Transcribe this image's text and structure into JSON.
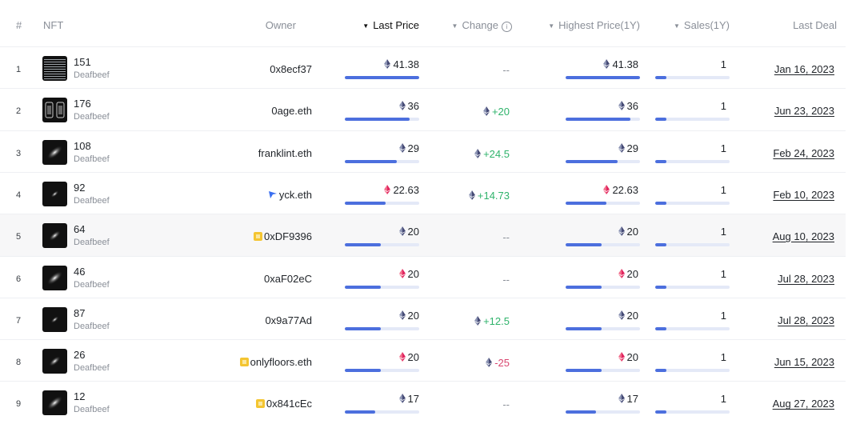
{
  "columns": {
    "index": "#",
    "nft": "NFT",
    "owner": "Owner",
    "last_price": "Last Price",
    "change": "Change",
    "highest_price": "Highest Price(1Y)",
    "sales": "Sales(1Y)",
    "last_deal": "Last Deal"
  },
  "sort": {
    "active_column": "last_price",
    "direction_icon": "caret-down-icon"
  },
  "colors": {
    "accent": "#4c6fde",
    "positive": "#2fb36b",
    "negative": "#d9466f",
    "muted": "#8a8f98"
  },
  "rows": [
    {
      "index": "1",
      "nft_id": "151",
      "collection": "Deafbeef",
      "owner": "0x8ecf37",
      "owner_icon": "",
      "last_price": "41.38",
      "last_price_icon": "eth-icon",
      "last_price_fraction": 1.0,
      "change": "--",
      "change_type": "none",
      "highest_price": "41.38",
      "highest_price_icon": "eth-icon",
      "highest_price_fraction": 1.0,
      "sales": "1",
      "sales_fraction": 0.15,
      "last_deal": "Jan 16, 2023",
      "highlight": false
    },
    {
      "index": "2",
      "nft_id": "176",
      "collection": "Deafbeef",
      "owner": "0age.eth",
      "owner_icon": "",
      "last_price": "36",
      "last_price_icon": "eth-icon",
      "last_price_fraction": 0.87,
      "change": "+20",
      "change_type": "pos",
      "highest_price": "36",
      "highest_price_icon": "eth-icon",
      "highest_price_fraction": 0.87,
      "sales": "1",
      "sales_fraction": 0.15,
      "last_deal": "Jun 23, 2023",
      "highlight": false
    },
    {
      "index": "3",
      "nft_id": "108",
      "collection": "Deafbeef",
      "owner": "franklint.eth",
      "owner_icon": "",
      "last_price": "29",
      "last_price_icon": "eth-icon",
      "last_price_fraction": 0.7,
      "change": "+24.5",
      "change_type": "pos",
      "highest_price": "29",
      "highest_price_icon": "eth-icon",
      "highest_price_fraction": 0.7,
      "sales": "1",
      "sales_fraction": 0.15,
      "last_deal": "Feb 24, 2023",
      "highlight": false
    },
    {
      "index": "4",
      "nft_id": "92",
      "collection": "Deafbeef",
      "owner": "yck.eth",
      "owner_icon": "blur-icon",
      "last_price": "22.63",
      "last_price_icon": "weth-icon",
      "last_price_fraction": 0.55,
      "change": "+14.73",
      "change_type": "pos",
      "highest_price": "22.63",
      "highest_price_icon": "weth-icon",
      "highest_price_fraction": 0.55,
      "sales": "1",
      "sales_fraction": 0.15,
      "last_deal": "Feb 10, 2023",
      "highlight": false
    },
    {
      "index": "5",
      "nft_id": "64",
      "collection": "Deafbeef",
      "owner": "0xDF9396",
      "owner_icon": "contract-icon",
      "last_price": "20",
      "last_price_icon": "eth-icon",
      "last_price_fraction": 0.48,
      "change": "--",
      "change_type": "none",
      "highest_price": "20",
      "highest_price_icon": "eth-icon",
      "highest_price_fraction": 0.48,
      "sales": "1",
      "sales_fraction": 0.15,
      "last_deal": "Aug 10, 2023",
      "highlight": true
    },
    {
      "index": "6",
      "nft_id": "46",
      "collection": "Deafbeef",
      "owner": "0xaF02eC",
      "owner_icon": "",
      "last_price": "20",
      "last_price_icon": "weth-icon",
      "last_price_fraction": 0.48,
      "change": "--",
      "change_type": "none",
      "highest_price": "20",
      "highest_price_icon": "weth-icon",
      "highest_price_fraction": 0.48,
      "sales": "1",
      "sales_fraction": 0.15,
      "last_deal": "Jul 28, 2023",
      "highlight": false
    },
    {
      "index": "7",
      "nft_id": "87",
      "collection": "Deafbeef",
      "owner": "0x9a77Ad",
      "owner_icon": "",
      "last_price": "20",
      "last_price_icon": "eth-icon",
      "last_price_fraction": 0.48,
      "change": "+12.5",
      "change_type": "pos",
      "highest_price": "20",
      "highest_price_icon": "eth-icon",
      "highest_price_fraction": 0.48,
      "sales": "1",
      "sales_fraction": 0.15,
      "last_deal": "Jul 28, 2023",
      "highlight": false
    },
    {
      "index": "8",
      "nft_id": "26",
      "collection": "Deafbeef",
      "owner": "onlyfloors.eth",
      "owner_icon": "contract-icon",
      "last_price": "20",
      "last_price_icon": "weth-icon",
      "last_price_fraction": 0.48,
      "change": "-25",
      "change_type": "neg",
      "highest_price": "20",
      "highest_price_icon": "weth-icon",
      "highest_price_fraction": 0.48,
      "sales": "1",
      "sales_fraction": 0.15,
      "last_deal": "Jun 15, 2023",
      "highlight": false
    },
    {
      "index": "9",
      "nft_id": "12",
      "collection": "Deafbeef",
      "owner": "0x841cEc",
      "owner_icon": "contract-icon",
      "last_price": "17",
      "last_price_icon": "eth-icon",
      "last_price_fraction": 0.41,
      "change": "--",
      "change_type": "none",
      "highest_price": "17",
      "highest_price_icon": "eth-icon",
      "highest_price_fraction": 0.41,
      "sales": "1",
      "sales_fraction": 0.15,
      "last_deal": "Aug 27, 2023",
      "highlight": false
    }
  ]
}
